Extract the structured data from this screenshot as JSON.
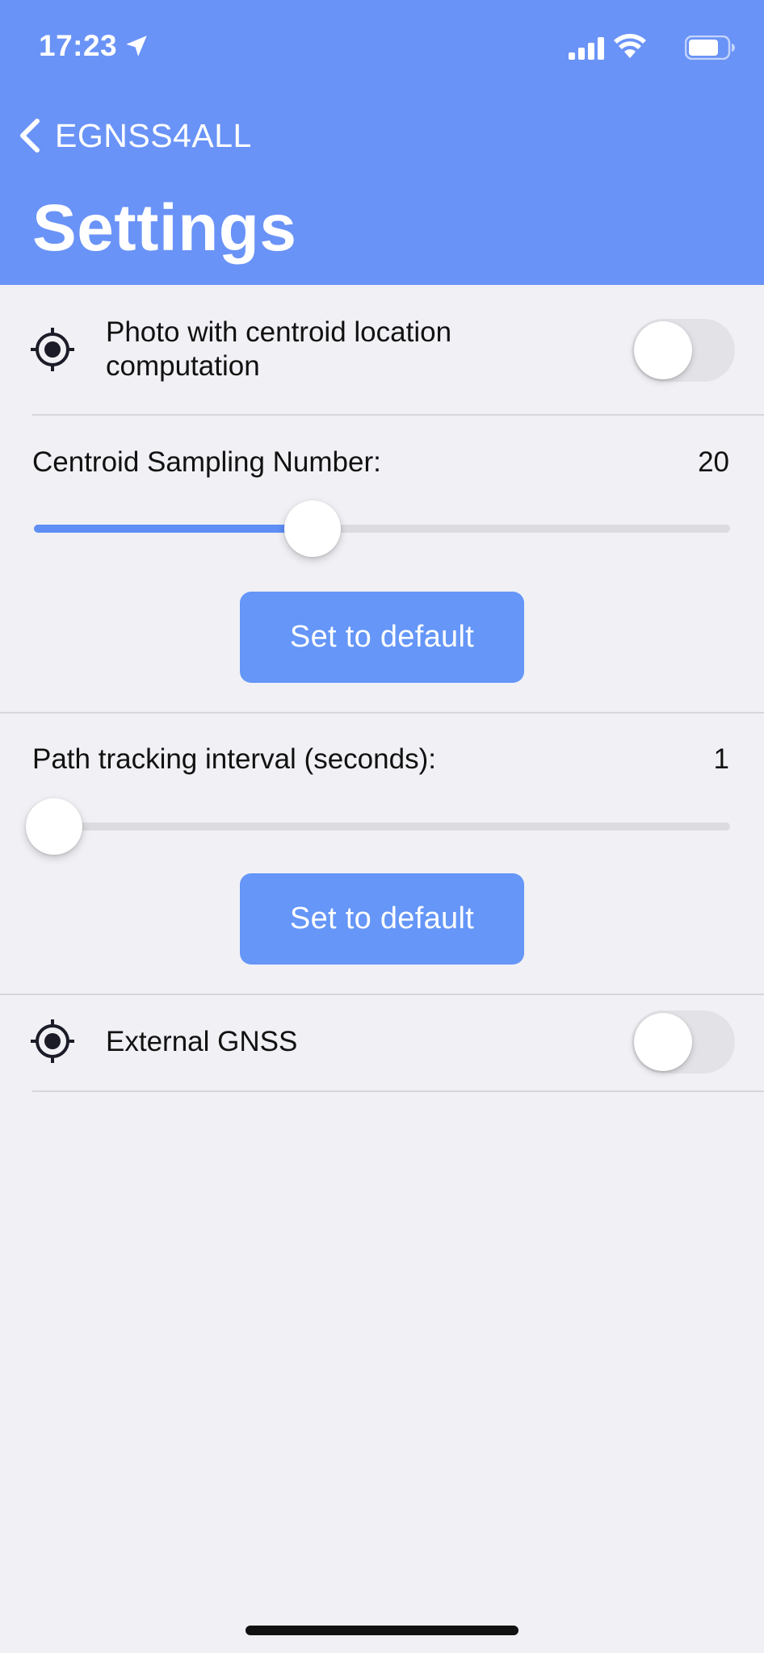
{
  "status_bar": {
    "time": "17:23",
    "icons": [
      "location-arrow-icon",
      "cellular-signal-icon",
      "wifi-icon",
      "battery-icon"
    ]
  },
  "nav": {
    "back_label": "EGNSS4ALL",
    "title": "Settings"
  },
  "settings": {
    "centroid_photo": {
      "label": "Photo with centroid location computation",
      "enabled": false,
      "icon": "target-icon"
    },
    "centroid_sampling": {
      "label": "Centroid Sampling Number:",
      "value": "20",
      "slider_fraction": 0.4,
      "default_button": "Set to default"
    },
    "path_tracking": {
      "label": "Path tracking interval (seconds):",
      "value": "1",
      "slider_fraction": 0.0,
      "default_button": "Set to default"
    },
    "external_gnss": {
      "label": "External GNSS",
      "enabled": false,
      "icon": "target-icon"
    }
  },
  "colors": {
    "header_bg": "#6a93f7",
    "accent": "#6596f8",
    "background": "#f0f0f5"
  }
}
